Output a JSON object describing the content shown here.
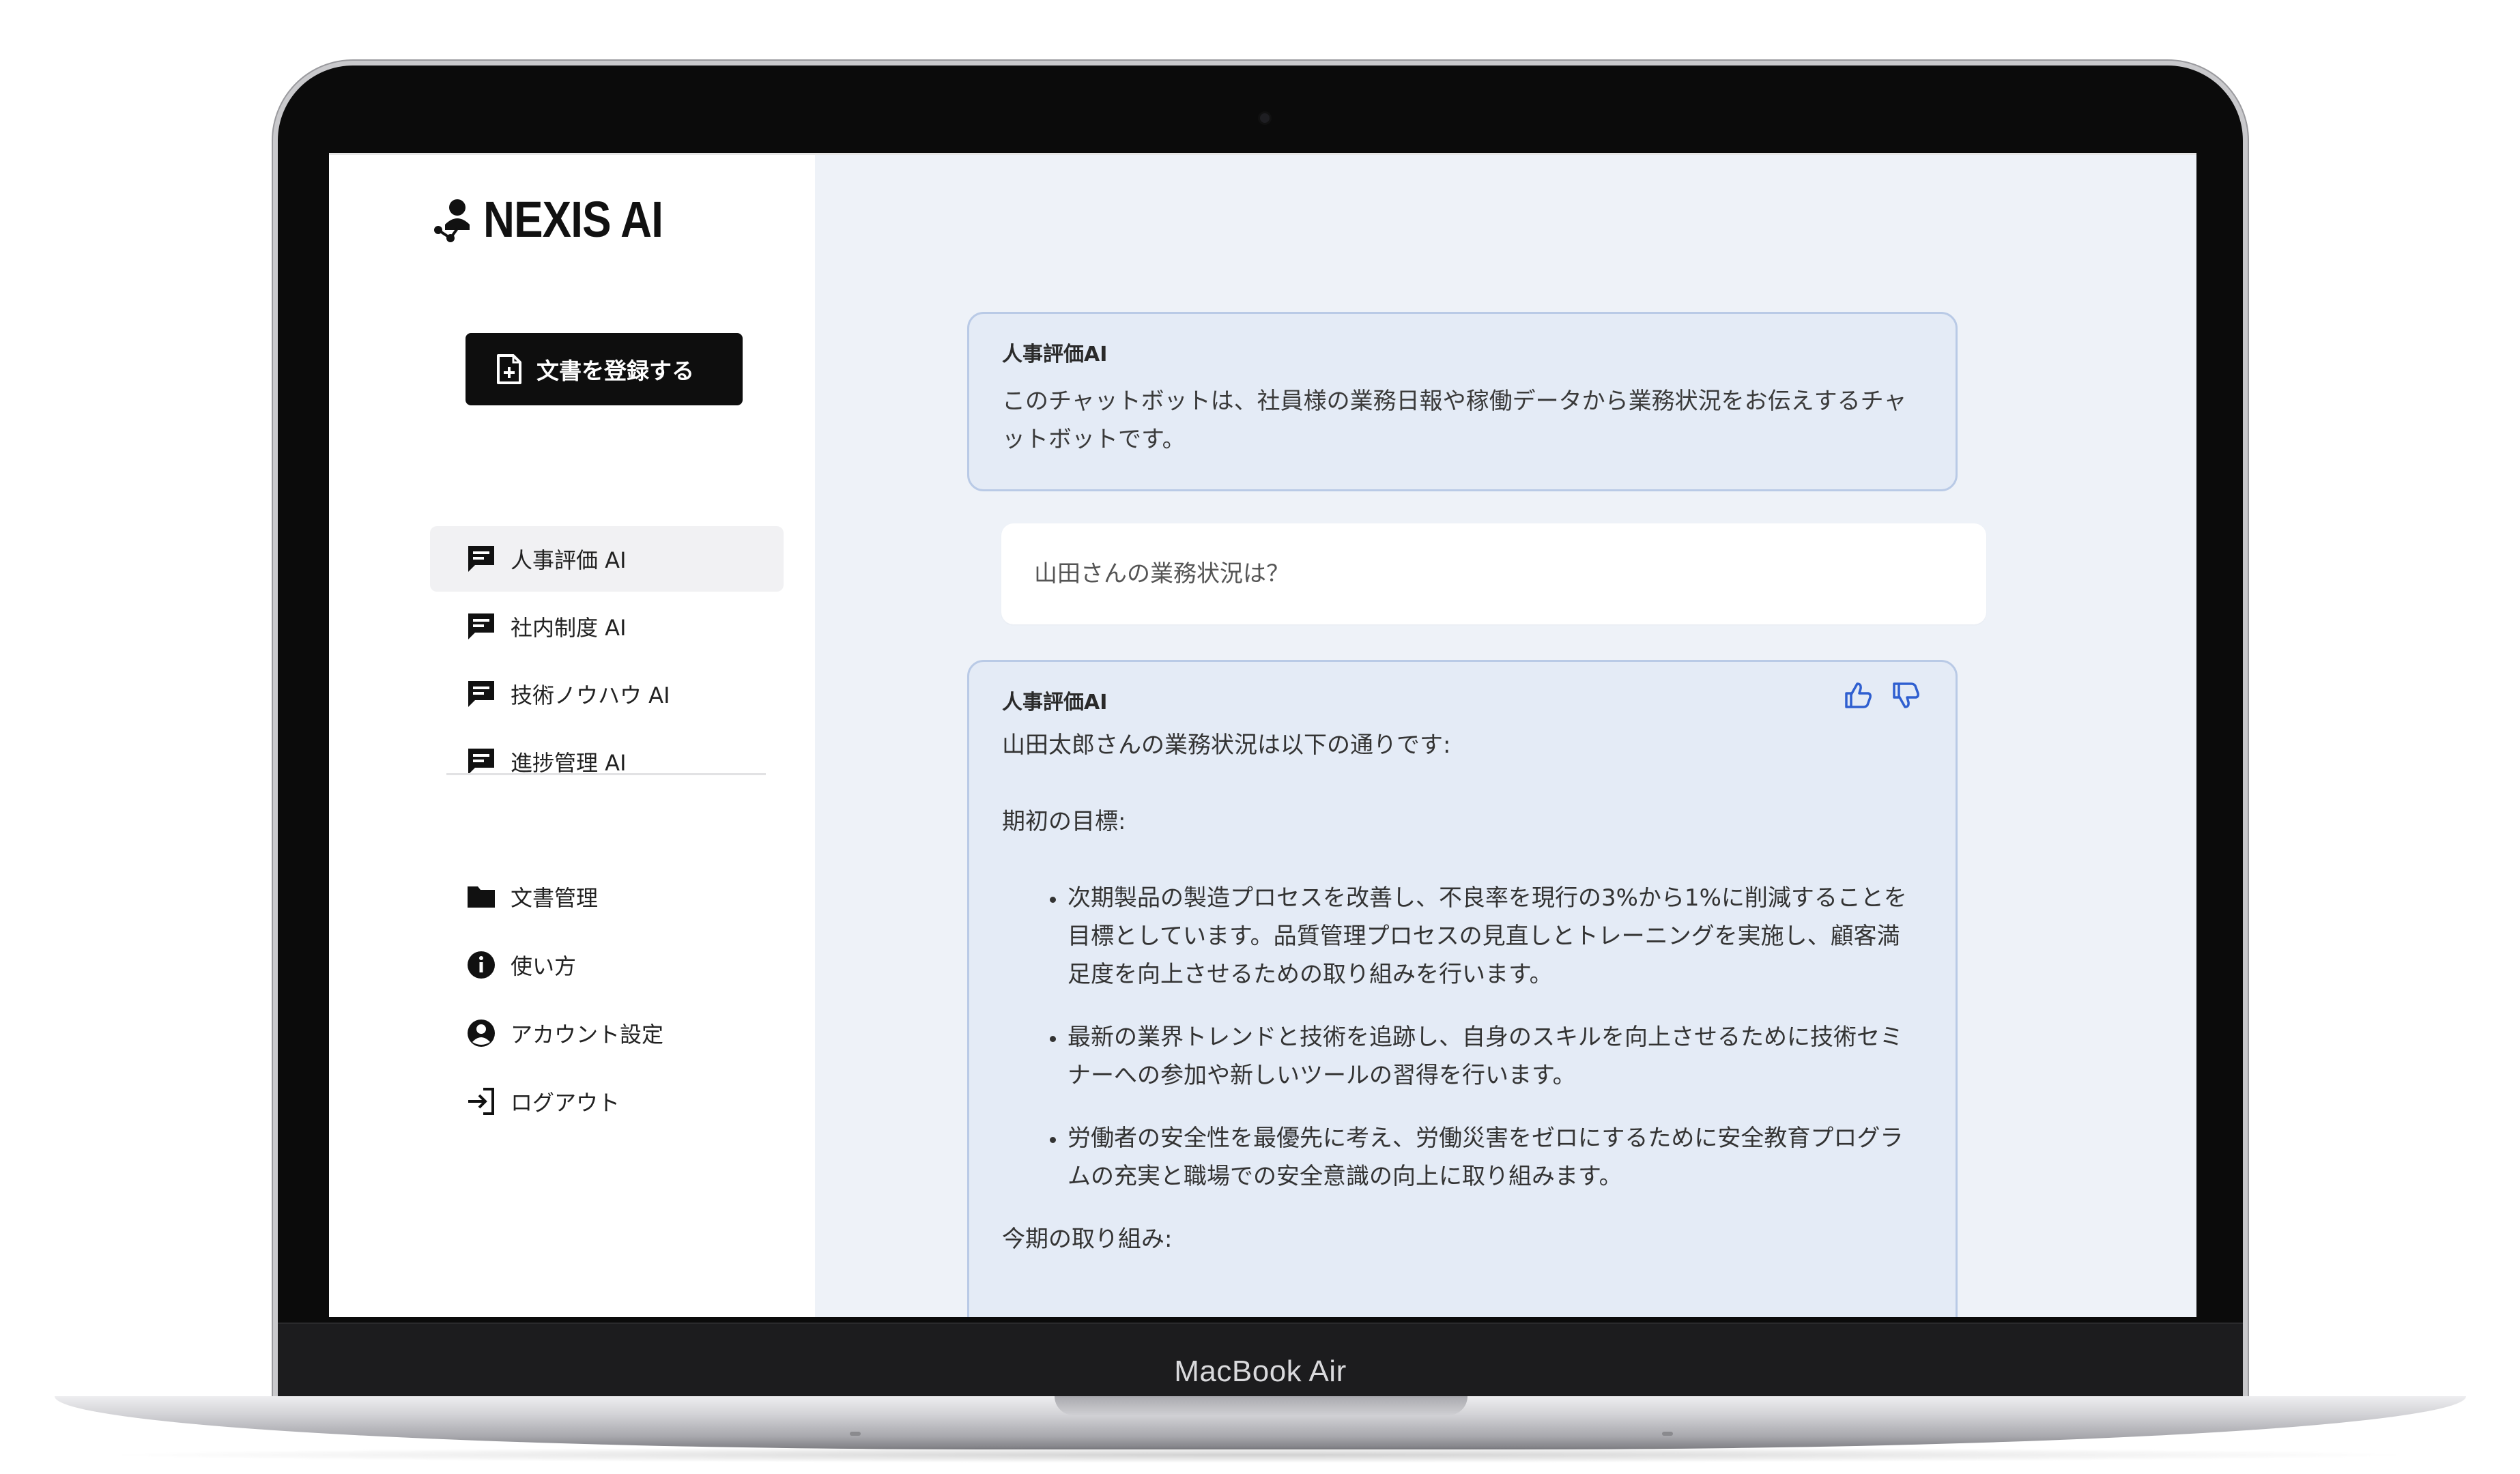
{
  "device": {
    "model_label": "MacBook Air"
  },
  "app": {
    "brand": "NEXIS AI"
  },
  "sidebar": {
    "register_button": "文書を登録する",
    "chatbots": [
      {
        "label": "人事評価 AI",
        "active": true,
        "icon": "chat-icon"
      },
      {
        "label": "社内制度 AI",
        "active": false,
        "icon": "chat-icon"
      },
      {
        "label": "技術ノウハウ AI",
        "active": false,
        "icon": "chat-icon"
      },
      {
        "label": "進捗管理 AI",
        "active": false,
        "icon": "chat-icon"
      }
    ],
    "menu": [
      {
        "label": "文書管理",
        "icon": "folder-icon"
      },
      {
        "label": "使い方",
        "icon": "info-icon"
      },
      {
        "label": "アカウント設定",
        "icon": "account-icon"
      },
      {
        "label": "ログアウト",
        "icon": "logout-icon"
      }
    ]
  },
  "chat": {
    "intro": {
      "name": "人事評価AI",
      "text": "このチャットボットは、社員様の業務日報や稼働データから業務状況をお伝えするチャットボットです。"
    },
    "user_question": "山田さんの業務状況は？",
    "answer": {
      "name": "人事評価AI",
      "lead": "山田太郎さんの業務状況は以下の通りです:",
      "section1_title": "期初の目標:",
      "bullets": [
        "次期製品の製造プロセスを改善し、不良率を現行の3%から1%に削減することを目標としています。品質管理プロセスの見直しとトレーニングを実施し、顧客満足度を向上させるための取り組みを行います。",
        "最新の業界トレンドと技術を追跡し、自身のスキルを向上させるために技術セミナーへの参加や新しいツールの習得を行います。",
        "労働者の安全性を最優先に考え、労働災害をゼロにするために安全教育プログラムの充実と職場での安全意識の向上に取り組みます。"
      ],
      "section2_title": "今期の取り組み:"
    }
  },
  "colors": {
    "accent_dark": "#0e0e0e",
    "main_background": "#eef2f8",
    "bot_bubble_fill": "#e4ebf6",
    "bot_bubble_border": "#b9cae6",
    "feedback_icon": "#2f5fd0"
  }
}
